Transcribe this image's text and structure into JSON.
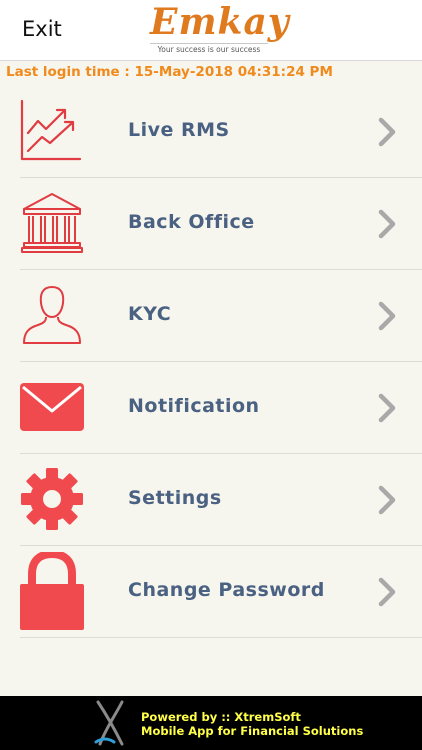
{
  "header": {
    "exit_label": "Exit",
    "logo_text": "Emkay",
    "logo_tagline": "Your success is our success"
  },
  "last_login": "Last login time : 15-May-2018 04:31:24 PM",
  "menu": {
    "items": [
      {
        "label": "Live RMS",
        "icon": "chart-trend-icon"
      },
      {
        "label": "Back Office",
        "icon": "bank-building-icon"
      },
      {
        "label": "KYC",
        "icon": "user-profile-icon"
      },
      {
        "label": "Notification",
        "icon": "envelope-icon"
      },
      {
        "label": "Settings",
        "icon": "gear-icon"
      },
      {
        "label": "Change Password",
        "icon": "padlock-icon"
      }
    ]
  },
  "footer": {
    "powered_by": "Powered by :: XtremSoft",
    "tagline": "Mobile App for Financial Solutions"
  },
  "colors": {
    "accent": "#f04a4e",
    "label": "#4a6182",
    "last_login": "#f08a1c",
    "footer_text": "#ffff4a",
    "logo": "#e07a1e"
  }
}
